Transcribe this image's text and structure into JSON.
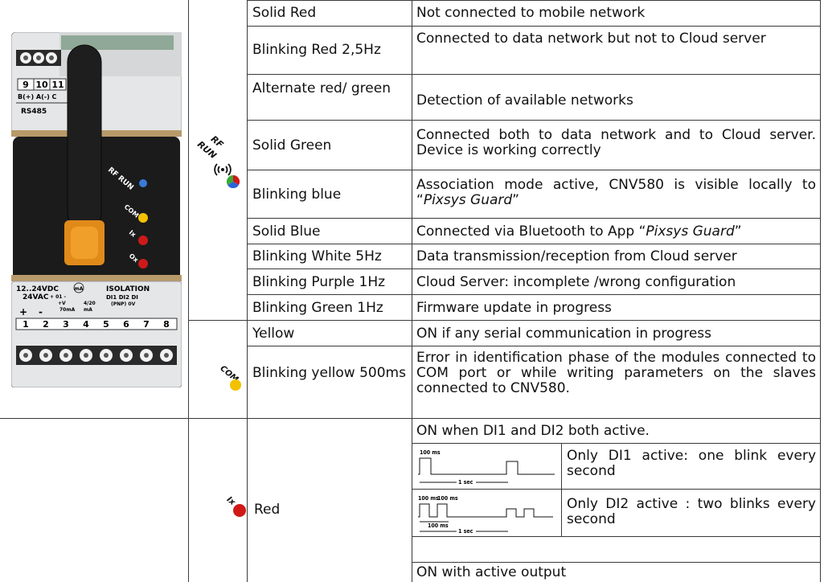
{
  "rf_rows": [
    {
      "state": "Solid Red",
      "desc": "Not connected to mobile network"
    },
    {
      "state": "Blinking Red 2,5Hz",
      "desc": "Connected to data network but not to Cloud server"
    },
    {
      "state": "Alternate red/ green",
      "desc": "Detection of available networks"
    },
    {
      "state": "Solid Green",
      "desc": "Connected both to data network and to Cloud server. Device is working correctly"
    },
    {
      "state": "Blinking blue",
      "desc_a": "Association mode active, CNV580 is visible locally to “",
      "desc_italic": "Pixsys Guard",
      "desc_b": "”"
    },
    {
      "state": "Solid Blue",
      "desc_a": "Connected via Bluetooth to App “",
      "desc_italic": "Pixsys Guard",
      "desc_b": "”"
    },
    {
      "state": "Blinking White 5Hz",
      "desc": "Data transmission/reception from Cloud server"
    },
    {
      "state": "Blinking Purple 1Hz",
      "desc": "Cloud Server: incomplete /wrong configuration"
    },
    {
      "state": "Blinking Green 1Hz",
      "desc": "Firmware update in progress"
    }
  ],
  "com_rows": [
    {
      "state": "Yellow",
      "desc": "ON if any serial communication in progress"
    },
    {
      "state": "Blinking yellow 500ms",
      "desc": "Error in identification phase of the modules connected to COM port or while writing parameters on the slaves connected to CNV580."
    }
  ],
  "ix_row": {
    "state": "Red",
    "top": "ON when DI1 and DI2 both active.",
    "sub1": "Only DI1 active: one blink every second",
    "sub2": "Only DI2 active : two blinks every second",
    "bottom": "ON with active output"
  },
  "led_labels": {
    "rf": "RF",
    "run": "RUN",
    "com": "COM",
    "ix": "Ix"
  },
  "waveform": {
    "pulse_width": "100 ms",
    "period": "1 sec"
  },
  "device": {
    "top_terminals": [
      "9",
      "10",
      "11"
    ],
    "top_signals": "B(+) A(-)  C",
    "bus": "RS485",
    "device_leds": [
      "RF RUN",
      "COM",
      "Ix",
      "Ox"
    ],
    "power_l1": "12..24VDC",
    "power_l2": "24VAC",
    "isolation": "ISOLATION",
    "io_l1": "DI1 DI2 DI",
    "io_l2": "(PNP) 0V",
    "bottom_terminals": [
      "1",
      "2",
      "3",
      "4",
      "5",
      "6",
      "7",
      "8"
    ],
    "ma_label": "mA",
    "signal_labels": {
      "o1": "+ 01 -",
      "v": "+V",
      "ma70": "70mA",
      "r420": "4/20",
      "ma": "mA",
      "plus": "+",
      "minus": "-"
    }
  },
  "colors": {
    "red": "#d01818",
    "yellow": "#f2c200",
    "green": "#3aa935",
    "blue": "#2a64d6",
    "grid": "#3a3a3a"
  }
}
